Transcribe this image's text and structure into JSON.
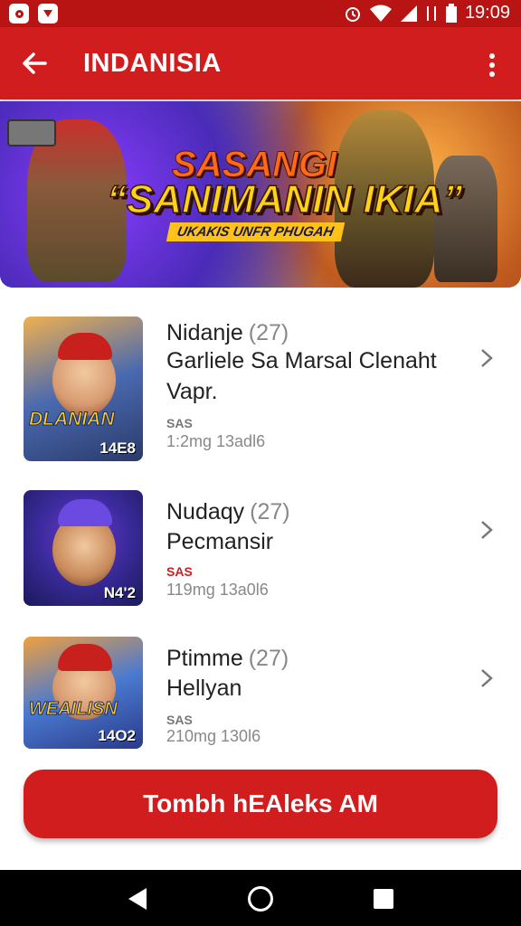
{
  "status_bar": {
    "time": "19:09"
  },
  "app_bar": {
    "title": "INDANISIA"
  },
  "banner": {
    "line1": "SASANGI",
    "line2": "“SANIMANIN IKIA”",
    "tagline": "UKAKIS UNFR PHUGAH",
    "slides": 3,
    "active_slide": 1
  },
  "items": [
    {
      "name": "Nidanje",
      "score": "(27)",
      "desc": "Garliele Sa Marsal Clenaht Vapr.",
      "rating": "SAS",
      "size": "1:2mg 13adl6",
      "thumb_label": "DLANIAN",
      "thumb_num": "14E8",
      "rating_color": "#777777"
    },
    {
      "name": "Nudaqy",
      "score": "(27)",
      "desc": "Pecmansir",
      "rating": "SAS",
      "size": "119mg 13a0l6",
      "thumb_label": "",
      "thumb_num": "N4'2",
      "rating_color": "#d11d1d"
    },
    {
      "name": "Ptimme",
      "score": "(27)",
      "desc": "Hellyan",
      "rating": "SAS",
      "size": "210mg 130l6",
      "thumb_label": "WEAILISN",
      "thumb_num": "14O2",
      "rating_color": "#777777"
    }
  ],
  "cta": {
    "label": "Tombh hEAleks AM"
  },
  "icons": {
    "back": "arrow-left-icon",
    "more": "more-vert-icon",
    "chevron": "chevron-right-icon"
  },
  "colors": {
    "primary": "#d11d1d",
    "status_bar": "#b81414",
    "nav_bar": "#000000"
  }
}
